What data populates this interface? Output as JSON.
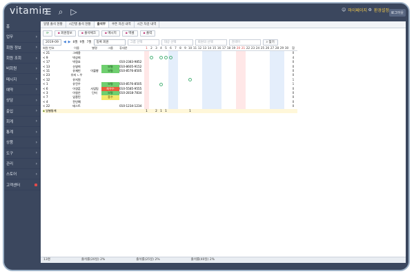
{
  "app": {
    "logo": "vitamin"
  },
  "topbar": {
    "user_label": "마이페이지",
    "settings_label": "환경설정",
    "logout_label": "로그아웃"
  },
  "sidebar": {
    "items": [
      {
        "label": "홈",
        "chev": ""
      },
      {
        "label": "업무",
        "chev": ">"
      },
      {
        "label": "회원 정보",
        "chev": ">"
      },
      {
        "label": "회원 조회",
        "chev": ">"
      },
      {
        "label": "비회원",
        "chev": ">"
      },
      {
        "label": "메시지",
        "chev": ">"
      },
      {
        "label": "예약",
        "chev": ">"
      },
      {
        "label": "상담",
        "chev": ">"
      },
      {
        "label": "출입",
        "chev": ">"
      },
      {
        "label": "회계",
        "chev": ">"
      },
      {
        "label": "통계",
        "chev": ">"
      },
      {
        "label": "상품",
        "chev": ">"
      },
      {
        "label": "도구",
        "chev": ">"
      },
      {
        "label": "관리",
        "chev": ">"
      },
      {
        "label": "스토어",
        "chev": ">"
      },
      {
        "label": "고객센터",
        "chev": "dot"
      }
    ]
  },
  "tabs": [
    "일별 출석 현황",
    "시간별 출석 현황",
    "출석부",
    "쿠폰 차감 내역",
    "시간 차감 내역"
  ],
  "active_tab": 2,
  "toolbar": [
    "회원정보",
    "출석체크",
    "메시지",
    "엑셀",
    "출력"
  ],
  "filter": {
    "month": "2019-09",
    "month_links": [
      "8월",
      "9월",
      "7월"
    ],
    "member_filter": "등록 회원",
    "select1": "그룹 선택",
    "select2": "대상 선택",
    "select3": "회원의 선택",
    "search_placeholder": "검색어",
    "search_button": "찾기"
  },
  "table": {
    "headers": [
      "회원 번호",
      "이름",
      "별명",
      "그룹",
      "휴대폰"
    ],
    "total_header": "합",
    "days": [
      "1",
      "2",
      "3",
      "4",
      "5",
      "6",
      "7",
      "8",
      "9",
      "10",
      "11",
      "12",
      "13",
      "14",
      "15",
      "16",
      "17",
      "18",
      "19",
      "20",
      "21",
      "22",
      "23",
      "24",
      "25",
      "26",
      "27",
      "28",
      "29",
      "30"
    ],
    "rows": [
      {
        "id": "< 21",
        "name": "그레용",
        "alias": "",
        "group": "",
        "gclass": "",
        "phone": "",
        "marks": [],
        "total": "0"
      },
      {
        "id": "< 9",
        "name": "박상희",
        "alias": "",
        "group": "",
        "gclass": "",
        "phone": "",
        "marks": [
          2,
          4,
          5,
          6
        ],
        "total": "4"
      },
      {
        "id": "< 17",
        "name": "박정호",
        "alias": "",
        "group": "",
        "gclass": "",
        "phone": "010-2383-9852",
        "marks": [],
        "total": "0"
      },
      {
        "id": "< 13",
        "name": "신영희",
        "alias": "",
        "group": "보통",
        "gclass": "g-green",
        "phone": "010-8605-9152",
        "marks": [],
        "total": "0"
      },
      {
        "id": "< 11",
        "name": "유재빈",
        "alias": "이불빵",
        "group": "보통",
        "gclass": "g-green",
        "phone": "010-8576-8505",
        "marks": [],
        "total": "0"
      },
      {
        "id": "< 23",
        "name": "유지 ㄴ우",
        "alias": "",
        "group": "",
        "gclass": "",
        "phone": "",
        "marks": [],
        "total": "0"
      },
      {
        "id": "< 12",
        "name": "유지원",
        "alias": "",
        "group": "",
        "gclass": "",
        "phone": "",
        "marks": [
          10
        ],
        "total": "1"
      },
      {
        "id": "< 1",
        "name": "유진우",
        "alias": "",
        "group": "보통",
        "gclass": "g-green",
        "phone": "010-8576-8505",
        "marks": [
          4
        ],
        "total": "1"
      },
      {
        "id": "< 6",
        "name": "이경훈",
        "alias": "사업팀",
        "group": "최우수",
        "gclass": "g-red",
        "phone": "010-5585-9555",
        "marks": [],
        "total": "0"
      },
      {
        "id": "< 3",
        "name": "이청은",
        "alias": "단미",
        "group": "보통",
        "gclass": "g-green",
        "phone": "010-2818-7834",
        "marks": [],
        "total": "0"
      },
      {
        "id": "< 7",
        "name": "임종민",
        "alias": "",
        "group": "중수",
        "gclass": "g-yellow",
        "phone": "",
        "marks": [],
        "total": "0"
      },
      {
        "id": "< 4",
        "name": "전인예",
        "alias": "",
        "group": "",
        "gclass": "",
        "phone": "",
        "marks": [],
        "total": "0"
      },
      {
        "id": "< 22",
        "name": "테스트",
        "alias": "",
        "group": "",
        "gclass": "",
        "phone": "010-1234-1234",
        "marks": [],
        "total": "0"
      }
    ],
    "summary_label": "일별통계",
    "summary_values": {
      "1": "1",
      "3": "2",
      "4": "1",
      "5": "1",
      "10": "1"
    }
  },
  "status": [
    "13명",
    "출석률(20일) 2%",
    "출석률(25일) 2%",
    "출석률(40일) 2%"
  ]
}
